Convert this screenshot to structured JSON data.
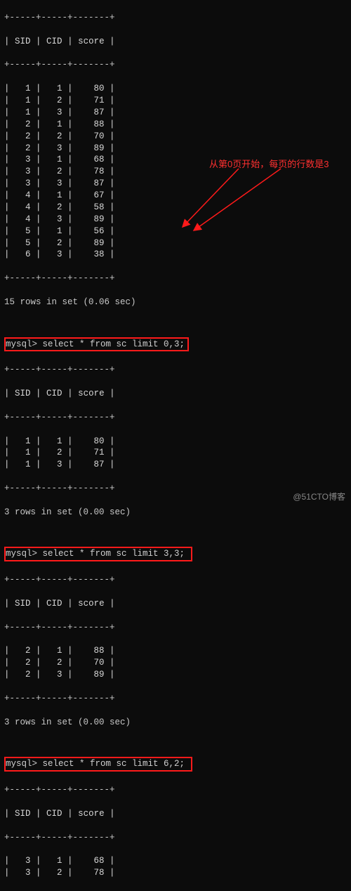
{
  "headers": {
    "sid": "SID",
    "cid": "CID",
    "score": "score"
  },
  "table1_rows": [
    {
      "sid": "1",
      "cid": "1",
      "score": "80"
    },
    {
      "sid": "1",
      "cid": "2",
      "score": "71"
    },
    {
      "sid": "1",
      "cid": "3",
      "score": "87"
    },
    {
      "sid": "2",
      "cid": "1",
      "score": "88"
    },
    {
      "sid": "2",
      "cid": "2",
      "score": "70"
    },
    {
      "sid": "2",
      "cid": "3",
      "score": "89"
    },
    {
      "sid": "3",
      "cid": "1",
      "score": "68"
    },
    {
      "sid": "3",
      "cid": "2",
      "score": "78"
    },
    {
      "sid": "3",
      "cid": "3",
      "score": "87"
    },
    {
      "sid": "4",
      "cid": "1",
      "score": "67"
    },
    {
      "sid": "4",
      "cid": "2",
      "score": "58"
    },
    {
      "sid": "4",
      "cid": "3",
      "score": "89"
    },
    {
      "sid": "5",
      "cid": "1",
      "score": "56"
    },
    {
      "sid": "5",
      "cid": "2",
      "score": "89"
    },
    {
      "sid": "6",
      "cid": "3",
      "score": "38"
    }
  ],
  "status1": "15 rows in set (0.06 sec)",
  "query1": "mysql> select * from sc limit 0,3;",
  "table2_rows": [
    {
      "sid": "1",
      "cid": "1",
      "score": "80"
    },
    {
      "sid": "1",
      "cid": "2",
      "score": "71"
    },
    {
      "sid": "1",
      "cid": "3",
      "score": "87"
    }
  ],
  "status2": "3 rows in set (0.00 sec)",
  "query2": "mysql> select * from sc limit 3,3;",
  "table3_rows": [
    {
      "sid": "2",
      "cid": "1",
      "score": "88"
    },
    {
      "sid": "2",
      "cid": "2",
      "score": "70"
    },
    {
      "sid": "2",
      "cid": "3",
      "score": "89"
    }
  ],
  "status3": "3 rows in set (0.00 sec)",
  "query3": "mysql> select * from sc limit 6,2;",
  "table4_rows": [
    {
      "sid": "3",
      "cid": "1",
      "score": "68"
    },
    {
      "sid": "3",
      "cid": "2",
      "score": "78"
    }
  ],
  "annotation": "从第0页开始，每页的行数是3",
  "watermark": "@51CTO博客",
  "separator": "+-----+-----+-------+"
}
